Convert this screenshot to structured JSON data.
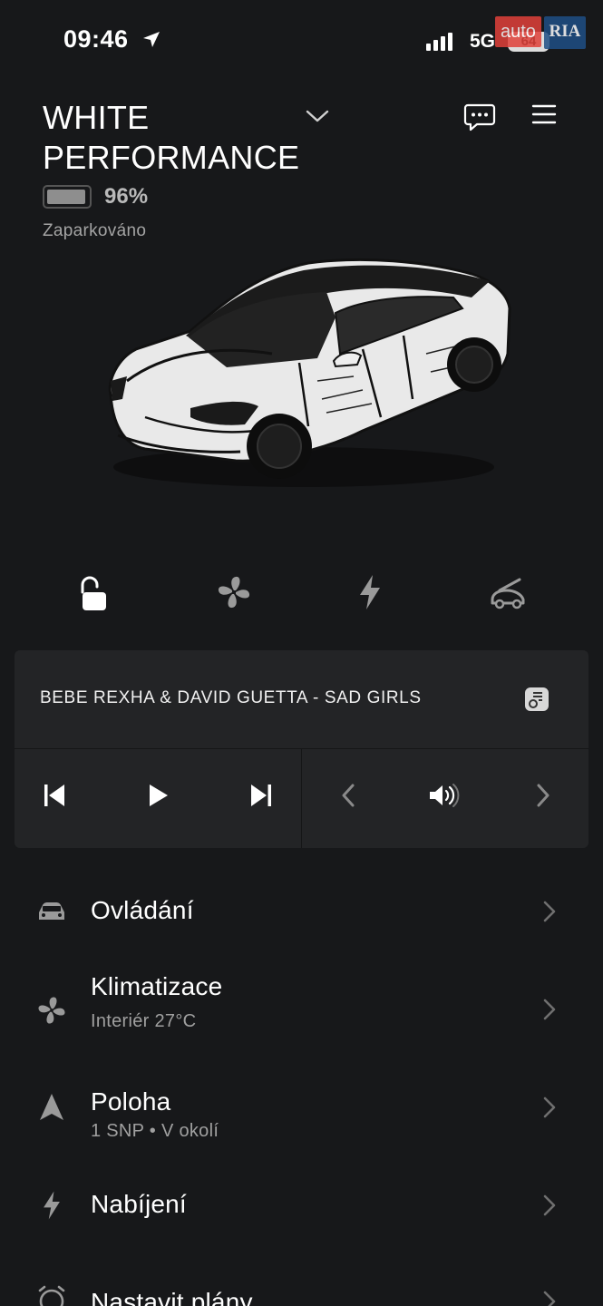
{
  "status_bar": {
    "time": "09:46",
    "network": "5G",
    "battery_level": "64",
    "icons": [
      "location-arrow-icon",
      "signal-icon",
      "battery-icon"
    ]
  },
  "watermark": {
    "part1": "auto",
    "part2": "RIA"
  },
  "header": {
    "car_name": "WHITE PERFORMANCE",
    "battery_percent": "96%",
    "battery_fraction": 0.96,
    "status": "Zaparkováno"
  },
  "quick_actions": [
    {
      "icon": "unlock-icon"
    },
    {
      "icon": "fan-icon"
    },
    {
      "icon": "bolt-icon"
    },
    {
      "icon": "frunk-icon"
    }
  ],
  "media": {
    "track": "BEBE REXHA & DAVID GUETTA - SAD GIRLS",
    "controls": [
      "previous-track-icon",
      "play-icon",
      "next-track-icon",
      "source-prev-icon",
      "volume-icon",
      "source-next-icon"
    ]
  },
  "menu": {
    "controls": {
      "title": "Ovládání"
    },
    "climate": {
      "title": "Klimatizace",
      "subtitle": "Interiér 27°C"
    },
    "location": {
      "title": "Poloha",
      "subtitle": "1 SNP • V okolí"
    },
    "charging": {
      "title": "Nabíjení"
    },
    "schedule": {
      "title": "Nastavit plány"
    }
  },
  "colors": {
    "background": "#17181a",
    "card": "#232426",
    "text_secondary": "#a0a0a0",
    "icon_gray": "#8a8a8a"
  }
}
